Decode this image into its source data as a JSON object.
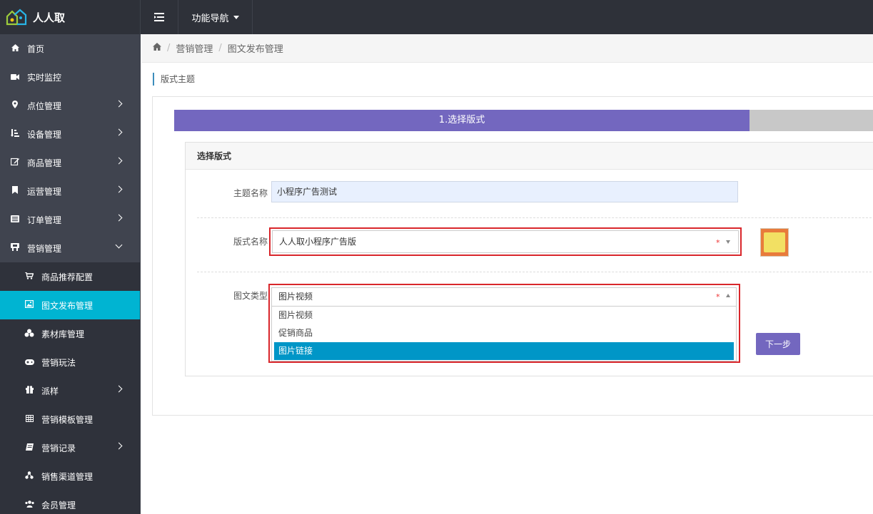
{
  "app": {
    "name": "人人取",
    "func_nav": "功能导航"
  },
  "sidebar": {
    "items": [
      {
        "label": "首页",
        "icon": "home-icon"
      },
      {
        "label": "实时监控",
        "icon": "video-icon"
      },
      {
        "label": "点位管理",
        "icon": "map-marker-icon"
      },
      {
        "label": "设备管理",
        "icon": "sort-icon"
      },
      {
        "label": "商品管理",
        "icon": "edit-icon"
      },
      {
        "label": "运营管理",
        "icon": "bookmark-icon"
      },
      {
        "label": "订单管理",
        "icon": "list-icon"
      },
      {
        "label": "营销管理",
        "icon": "marketing-icon"
      }
    ],
    "sub_items": [
      {
        "label": "商品推荐配置",
        "icon": "cart-icon"
      },
      {
        "label": "图文发布管理",
        "icon": "image-icon"
      },
      {
        "label": "素材库管理",
        "icon": "cubes-icon"
      },
      {
        "label": "营销玩法",
        "icon": "gamepad-icon"
      },
      {
        "label": "派样",
        "icon": "gift-icon"
      },
      {
        "label": "营销模板管理",
        "icon": "table-icon"
      },
      {
        "label": "营销记录",
        "icon": "book-icon"
      },
      {
        "label": "销售渠道管理",
        "icon": "share-icon"
      },
      {
        "label": "会员管理",
        "icon": "users-icon"
      }
    ]
  },
  "breadcrumb": {
    "home_icon": "home-icon",
    "items": [
      "营销管理",
      "图文发布管理"
    ]
  },
  "section_title": "版式主题",
  "steps": {
    "active": "1.选择版式"
  },
  "panel": {
    "title": "选择版式",
    "theme_label": "主题名称",
    "theme_value": "小程序广告测试",
    "layout_label": "版式名称",
    "layout_value": "人人取小程序广告版",
    "type_label": "图文类型",
    "type_value": "图片视频",
    "required_mark": "*",
    "type_options": [
      "图片视频",
      "促销商品",
      "图片链接"
    ],
    "type_highlighted": "图片链接",
    "next_button": "下一步"
  },
  "colors": {
    "sidebar_bg": "#40444f",
    "topbar_bg": "#2e3139",
    "active_item": "#00b4d2",
    "step_active": "#7367bf",
    "highlight": "#d9262b",
    "dropdown_highlight": "#0096c7"
  }
}
